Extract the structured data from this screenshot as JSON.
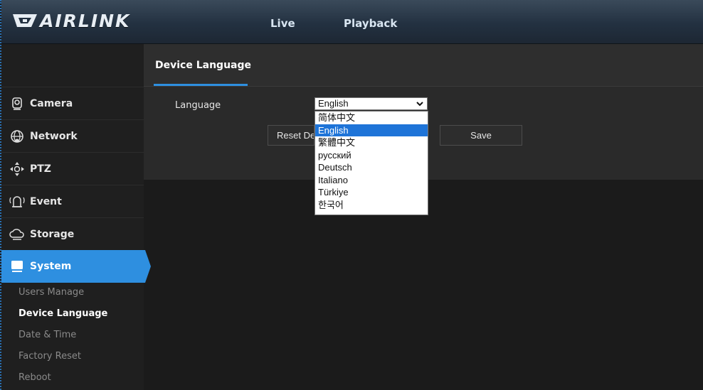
{
  "header": {
    "logo_text": "AIRLINK",
    "tabs": [
      {
        "label": "Live"
      },
      {
        "label": "Playback"
      }
    ]
  },
  "sidebar": {
    "items": [
      {
        "label": "Camera",
        "icon": "camera-icon"
      },
      {
        "label": "Network",
        "icon": "network-globe-icon"
      },
      {
        "label": "PTZ",
        "icon": "ptz-direction-icon"
      },
      {
        "label": "Event",
        "icon": "event-alarm-icon"
      },
      {
        "label": "Storage",
        "icon": "storage-cloud-icon"
      },
      {
        "label": "System",
        "icon": "system-monitor-icon",
        "active": true
      }
    ],
    "sub_items": [
      {
        "label": "Users Manage"
      },
      {
        "label": "Device Language",
        "current": true
      },
      {
        "label": "Date & Time"
      },
      {
        "label": "Factory Reset"
      },
      {
        "label": "Reboot"
      }
    ]
  },
  "main": {
    "title": "Device Language",
    "language_label": "Language",
    "language_value": "English",
    "language_options": [
      "简体中文",
      "English",
      "繁體中文",
      "русский",
      "Deutsch",
      "Italiano",
      "Türkiye",
      "한국어"
    ],
    "selected_option": "English",
    "reset_button": "Reset De",
    "save_button": "Save"
  },
  "colors": {
    "accent": "#2e8fe0",
    "selection": "#1e74d8",
    "background": "#1b1b1b"
  }
}
